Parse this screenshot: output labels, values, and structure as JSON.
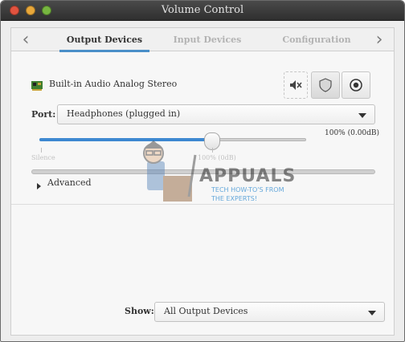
{
  "window": {
    "title": "Volume Control"
  },
  "tabs": [
    {
      "label": "Output Devices",
      "active": true
    },
    {
      "label": "Input Devices",
      "active": false
    },
    {
      "label": "Configuration",
      "active": false
    }
  ],
  "nav": {
    "prev_icon": "chevron-left-icon",
    "next_icon": "chevron-right-icon"
  },
  "device": {
    "name": "Built-in Audio Analog Stereo",
    "icon": "sound-card-icon",
    "buttons": [
      {
        "name": "mute",
        "icon": "speaker-muted-icon"
      },
      {
        "name": "lock-channels",
        "icon": "shield-icon"
      },
      {
        "name": "set-as-fallback",
        "icon": "radio-target-icon"
      }
    ]
  },
  "port": {
    "label": "Port:",
    "value": "Headphones (plugged in)"
  },
  "volume": {
    "value_text": "100% (0.00dB)",
    "fraction": 0.66,
    "silence_label": "Silence",
    "mark_label": "100% (0dB)"
  },
  "advanced": {
    "label": "Advanced"
  },
  "show": {
    "label": "Show:",
    "value": "All Output Devices"
  },
  "watermark": {
    "brand": "APPUALS",
    "tagline": "TECH HOW-TO'S FROM THE EXPERTS!"
  },
  "colors": {
    "accent": "#4a8fc8",
    "slider_fill": "#3d88d1"
  }
}
